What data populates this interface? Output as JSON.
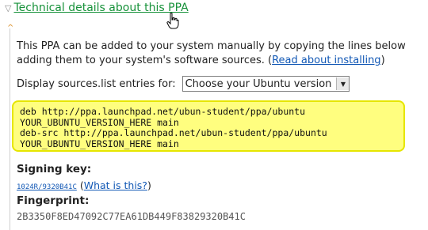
{
  "section": {
    "title": "Technical details about this PPA"
  },
  "intro": {
    "line1": "This PPA can be added to your system manually by copying the lines below",
    "line2_prefix": "adding them to your system's software sources. (",
    "read_link": "Read about installing",
    "line2_suffix": ")"
  },
  "sources": {
    "label": "Display sources.list entries for:",
    "selected_version": "Choose your Ubuntu version",
    "entries": [
      "deb http://ppa.launchpad.net/ubun-student/ppa/ubuntu",
      "YOUR_UBUNTU_VERSION_HERE main",
      "deb-src http://ppa.launchpad.net/ubun-student/ppa/ubuntu",
      "YOUR_UBUNTU_VERSION_HERE main"
    ]
  },
  "signing": {
    "label": "Signing key:",
    "key": "1024R/9320B41C",
    "what_prefix": " (",
    "what_link": "What is this?",
    "what_suffix": ")"
  },
  "fingerprint": {
    "label": "Fingerprint:",
    "value": "2B3350F8ED47092C77EA61DB449F83829320B41C"
  },
  "colors": {
    "section_link": "#17923a",
    "link": "#1258b5",
    "highlight_bg": "#fffe7f",
    "highlight_border": "#e6e600"
  },
  "icons": [
    "triangle-down-icon",
    "hand-cursor-icon",
    "caret-up-icon",
    "dropdown-arrow-icon"
  ]
}
